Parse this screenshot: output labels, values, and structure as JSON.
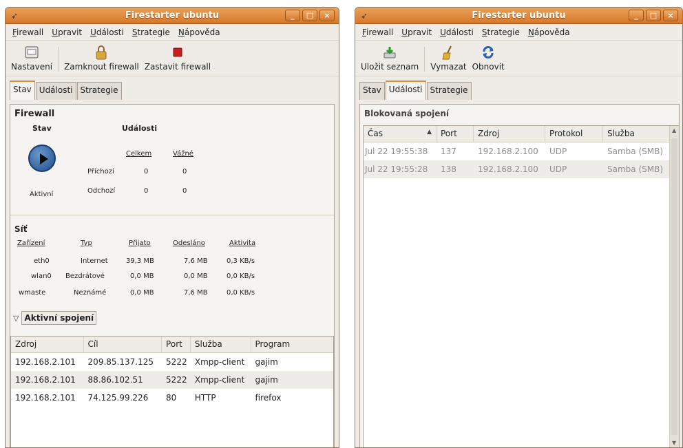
{
  "left_window": {
    "title": "Firestarter ubuntu",
    "window_buttons": [
      "_",
      "□",
      "×"
    ],
    "menu": [
      "Firewall",
      "Upravit",
      "Události",
      "Strategie",
      "Nápověda"
    ],
    "toolbar": [
      {
        "label": "Nastavení",
        "icon": "settings-icon"
      },
      {
        "label": "Zamknout firewall",
        "icon": "lock-icon"
      },
      {
        "label": "Zastavit firewall",
        "icon": "stop-icon"
      }
    ],
    "tabs": [
      "Stav",
      "Události",
      "Strategie"
    ],
    "active_tab": "Stav",
    "firewall": {
      "heading": "Firewall",
      "status_label": "Stav",
      "events_label": "Události",
      "status_value": "Aktivní",
      "col_total": "Celkem",
      "col_serious": "Vážné",
      "incoming_label": "Příchozí",
      "incoming_total": "0",
      "incoming_serious": "0",
      "outgoing_label": "Odchozí",
      "outgoing_total": "0",
      "outgoing_serious": "0"
    },
    "network": {
      "heading": "Síť",
      "headers": [
        "Zařízení",
        "Typ",
        "Přijato",
        "Odesláno",
        "Aktivita"
      ],
      "rows": [
        [
          "eth0",
          "Internet",
          "39,3 MB",
          "7,6 MB",
          "0,3 KB/s"
        ],
        [
          "wlan0",
          "Bezdrátové",
          "0,0 MB",
          "0,0 MB",
          "0,0 KB/s"
        ],
        [
          "wmaste",
          "Neznámé",
          "0,0 MB",
          "7,6 MB",
          "0,0 KB/s"
        ]
      ]
    },
    "connections": {
      "expander_label": "Aktivní spojení",
      "headers": [
        "Zdroj",
        "Cíl",
        "Port",
        "Služba",
        "Program"
      ],
      "rows": [
        [
          "192.168.2.101",
          "209.85.137.125",
          "5222",
          "Xmpp-client",
          "gajim"
        ],
        [
          "192.168.2.101",
          "88.86.102.51",
          "5222",
          "Xmpp-client",
          "gajim"
        ],
        [
          "192.168.2.101",
          "74.125.99.226",
          "80",
          "HTTP",
          "firefox"
        ]
      ]
    }
  },
  "right_window": {
    "title": "Firestarter ubuntu",
    "window_buttons": [
      "_",
      "□",
      "×"
    ],
    "menu": [
      "Firewall",
      "Upravit",
      "Události",
      "Strategie",
      "Nápověda"
    ],
    "toolbar": [
      {
        "label": "Uložit seznam",
        "icon": "save-icon"
      },
      {
        "label": "Vymazat",
        "icon": "broom-icon"
      },
      {
        "label": "Obnovit",
        "icon": "refresh-icon"
      }
    ],
    "tabs": [
      "Stav",
      "Události",
      "Strategie"
    ],
    "active_tab": "Události",
    "blocked": {
      "heading": "Blokovaná spojení",
      "headers": [
        "Čas",
        "Port",
        "Zdroj",
        "Protokol",
        "Služba"
      ],
      "sort_indicator": "▲",
      "rows": [
        [
          "Jul 22 19:55:38",
          "137",
          "192.168.2.100",
          "UDP",
          "Samba (SMB)"
        ],
        [
          "Jul 22 19:55:28",
          "138",
          "192.168.2.100",
          "UDP",
          "Samba (SMB)"
        ]
      ]
    }
  }
}
